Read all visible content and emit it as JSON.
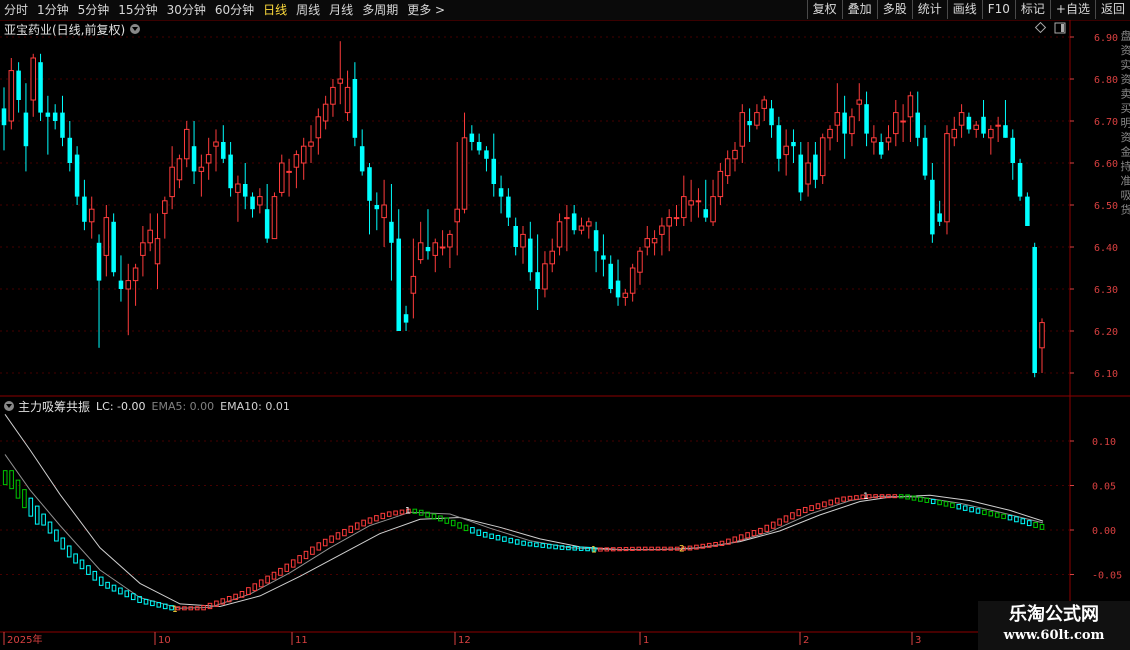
{
  "toolbar": {
    "left": [
      "分时",
      "1分钟",
      "5分钟",
      "15分钟",
      "30分钟",
      "60分钟",
      "日线",
      "周线",
      "月线",
      "多周期",
      "更多 >"
    ],
    "active_index": 6,
    "right": [
      "复权",
      "叠加",
      "多股",
      "统计",
      "画线",
      "F10",
      "标记",
      "+自选",
      "返回"
    ]
  },
  "stock_title": "亚宝药业(日线,前复权)",
  "price_axis": [
    "6.90",
    "6.80",
    "6.70",
    "6.60",
    "6.50",
    "6.40",
    "6.30",
    "6.20",
    "6.10"
  ],
  "indicator": {
    "name": "主力吸筹共振",
    "lc_label": "LC: -0.00",
    "ema5_label": "EMA5: 0.00",
    "ema10_label": "EMA10: 0.01",
    "axis": [
      "0.10",
      "0.05",
      "0.00",
      "-0.05"
    ],
    "markers": [
      "1",
      "1",
      "1",
      "2",
      "1"
    ]
  },
  "date_axis": [
    "2025年",
    "10",
    "11",
    "12",
    "1",
    "2",
    "3"
  ],
  "side_text": "盘 资 实 资 卖 买 明 资 金 持 准 吸 货",
  "watermark": {
    "cn": "乐淘公式网",
    "url": "www.60lt.com"
  },
  "colors": {
    "up": "#ff3c3c",
    "down": "#00ffff",
    "accent": "#ffdc3c",
    "ind_up": "#ff3c3c",
    "ind_down": "#00ffff",
    "ind_green": "#00c800",
    "grid": "#8b0000"
  },
  "chart_data": {
    "type": "candlestick",
    "title": "亚宝药业(日线,前复权)",
    "y_range": [
      6.1,
      6.9
    ],
    "candles_ohlc": [
      [
        6.73,
        6.78,
        6.63,
        6.69
      ],
      [
        6.7,
        6.85,
        6.68,
        6.82
      ],
      [
        6.82,
        6.84,
        6.72,
        6.75
      ],
      [
        6.72,
        6.79,
        6.58,
        6.64
      ],
      [
        6.75,
        6.86,
        6.71,
        6.85
      ],
      [
        6.84,
        6.86,
        6.7,
        6.72
      ],
      [
        6.72,
        6.76,
        6.62,
        6.71
      ],
      [
        6.72,
        6.74,
        6.68,
        6.7
      ],
      [
        6.72,
        6.76,
        6.64,
        6.66
      ],
      [
        6.66,
        6.7,
        6.58,
        6.6
      ],
      [
        6.62,
        6.64,
        6.5,
        6.52
      ],
      [
        6.52,
        6.56,
        6.44,
        6.46
      ],
      [
        6.46,
        6.52,
        6.42,
        6.49
      ],
      [
        6.41,
        6.43,
        6.16,
        6.32
      ],
      [
        6.38,
        6.5,
        6.33,
        6.47
      ],
      [
        6.46,
        6.48,
        6.33,
        6.34
      ],
      [
        6.32,
        6.38,
        6.27,
        6.3
      ],
      [
        6.3,
        6.36,
        6.19,
        6.32
      ],
      [
        6.32,
        6.36,
        6.26,
        6.35
      ],
      [
        6.38,
        6.45,
        6.33,
        6.41
      ],
      [
        6.41,
        6.48,
        6.39,
        6.44
      ],
      [
        6.36,
        6.48,
        6.3,
        6.42
      ],
      [
        6.48,
        6.52,
        6.42,
        6.51
      ],
      [
        6.52,
        6.64,
        6.49,
        6.59
      ],
      [
        6.56,
        6.62,
        6.54,
        6.61
      ],
      [
        6.61,
        6.7,
        6.59,
        6.68
      ],
      [
        6.64,
        6.7,
        6.55,
        6.58
      ],
      [
        6.58,
        6.62,
        6.52,
        6.59
      ],
      [
        6.6,
        6.66,
        6.56,
        6.62
      ],
      [
        6.64,
        6.68,
        6.58,
        6.65
      ],
      [
        6.65,
        6.69,
        6.6,
        6.61
      ],
      [
        6.62,
        6.65,
        6.52,
        6.54
      ],
      [
        6.53,
        6.57,
        6.46,
        6.55
      ],
      [
        6.55,
        6.6,
        6.49,
        6.52
      ],
      [
        6.52,
        6.53,
        6.47,
        6.49
      ],
      [
        6.5,
        6.54,
        6.48,
        6.52
      ],
      [
        6.49,
        6.55,
        6.41,
        6.42
      ],
      [
        6.42,
        6.53,
        6.42,
        6.52
      ],
      [
        6.53,
        6.62,
        6.52,
        6.6
      ],
      [
        6.58,
        6.61,
        6.52,
        6.58
      ],
      [
        6.59,
        6.63,
        6.54,
        6.62
      ],
      [
        6.6,
        6.66,
        6.56,
        6.64
      ],
      [
        6.64,
        6.69,
        6.6,
        6.65
      ],
      [
        6.66,
        6.73,
        6.62,
        6.71
      ],
      [
        6.7,
        6.76,
        6.68,
        6.74
      ],
      [
        6.74,
        6.8,
        6.71,
        6.78
      ],
      [
        6.79,
        6.89,
        6.74,
        6.8
      ],
      [
        6.72,
        6.82,
        6.7,
        6.78
      ],
      [
        6.8,
        6.84,
        6.64,
        6.66
      ],
      [
        6.64,
        6.68,
        6.57,
        6.58
      ],
      [
        6.59,
        6.6,
        6.43,
        6.51
      ],
      [
        6.5,
        6.53,
        6.44,
        6.49
      ],
      [
        6.47,
        6.56,
        6.4,
        6.5
      ],
      [
        6.46,
        6.55,
        6.32,
        6.41
      ],
      [
        6.42,
        6.49,
        6.2,
        6.2
      ],
      [
        6.24,
        6.26,
        6.2,
        6.22
      ],
      [
        6.29,
        6.42,
        6.23,
        6.33
      ],
      [
        6.37,
        6.46,
        6.36,
        6.41
      ],
      [
        6.4,
        6.49,
        6.37,
        6.39
      ],
      [
        6.38,
        6.42,
        6.34,
        6.41
      ],
      [
        6.4,
        6.44,
        6.38,
        6.4
      ],
      [
        6.4,
        6.44,
        6.35,
        6.43
      ],
      [
        6.46,
        6.65,
        6.38,
        6.49
      ],
      [
        6.49,
        6.72,
        6.48,
        6.66
      ],
      [
        6.67,
        6.69,
        6.63,
        6.65
      ],
      [
        6.65,
        6.67,
        6.62,
        6.63
      ],
      [
        6.63,
        6.64,
        6.58,
        6.61
      ],
      [
        6.61,
        6.67,
        6.52,
        6.55
      ],
      [
        6.54,
        6.57,
        6.48,
        6.52
      ],
      [
        6.52,
        6.54,
        6.45,
        6.47
      ],
      [
        6.45,
        6.47,
        6.38,
        6.4
      ],
      [
        6.4,
        6.45,
        6.36,
        6.43
      ],
      [
        6.42,
        6.46,
        6.32,
        6.34
      ],
      [
        6.34,
        6.43,
        6.25,
        6.3
      ],
      [
        6.3,
        6.39,
        6.28,
        6.36
      ],
      [
        6.36,
        6.42,
        6.34,
        6.39
      ],
      [
        6.4,
        6.48,
        6.38,
        6.46
      ],
      [
        6.47,
        6.5,
        6.39,
        6.47
      ],
      [
        6.48,
        6.5,
        6.43,
        6.44
      ],
      [
        6.44,
        6.47,
        6.43,
        6.45
      ],
      [
        6.45,
        6.47,
        6.42,
        6.46
      ],
      [
        6.44,
        6.46,
        6.34,
        6.39
      ],
      [
        6.38,
        6.43,
        6.33,
        6.37
      ],
      [
        6.36,
        6.38,
        6.29,
        6.3
      ],
      [
        6.32,
        6.37,
        6.26,
        6.28
      ],
      [
        6.28,
        6.3,
        6.26,
        6.29
      ],
      [
        6.29,
        6.36,
        6.27,
        6.35
      ],
      [
        6.34,
        6.4,
        6.31,
        6.39
      ],
      [
        6.4,
        6.45,
        6.38,
        6.42
      ],
      [
        6.41,
        6.44,
        6.38,
        6.42
      ],
      [
        6.43,
        6.47,
        6.38,
        6.45
      ],
      [
        6.45,
        6.49,
        6.39,
        6.47
      ],
      [
        6.47,
        6.5,
        6.45,
        6.47
      ],
      [
        6.47,
        6.57,
        6.45,
        6.52
      ],
      [
        6.5,
        6.56,
        6.46,
        6.51
      ],
      [
        6.51,
        6.54,
        6.47,
        6.51
      ],
      [
        6.49,
        6.56,
        6.46,
        6.47
      ],
      [
        6.46,
        6.56,
        6.45,
        6.52
      ],
      [
        6.52,
        6.6,
        6.5,
        6.58
      ],
      [
        6.57,
        6.63,
        6.55,
        6.61
      ],
      [
        6.61,
        6.65,
        6.58,
        6.63
      ],
      [
        6.64,
        6.74,
        6.6,
        6.72
      ],
      [
        6.7,
        6.73,
        6.65,
        6.69
      ],
      [
        6.69,
        6.74,
        6.68,
        6.72
      ],
      [
        6.73,
        6.76,
        6.7,
        6.75
      ],
      [
        6.73,
        6.75,
        6.66,
        6.69
      ],
      [
        6.69,
        6.71,
        6.58,
        6.61
      ],
      [
        6.62,
        6.68,
        6.57,
        6.64
      ],
      [
        6.65,
        6.68,
        6.6,
        6.64
      ],
      [
        6.62,
        6.65,
        6.51,
        6.53
      ],
      [
        6.55,
        6.65,
        6.52,
        6.6
      ],
      [
        6.62,
        6.65,
        6.54,
        6.56
      ],
      [
        6.57,
        6.67,
        6.55,
        6.66
      ],
      [
        6.66,
        6.69,
        6.63,
        6.68
      ],
      [
        6.69,
        6.79,
        6.65,
        6.72
      ],
      [
        6.72,
        6.76,
        6.61,
        6.67
      ],
      [
        6.67,
        6.73,
        6.64,
        6.71
      ],
      [
        6.74,
        6.79,
        6.7,
        6.75
      ],
      [
        6.74,
        6.77,
        6.64,
        6.67
      ],
      [
        6.65,
        6.69,
        6.62,
        6.66
      ],
      [
        6.65,
        6.67,
        6.61,
        6.62
      ],
      [
        6.65,
        6.69,
        6.63,
        6.66
      ],
      [
        6.67,
        6.75,
        6.64,
        6.72
      ],
      [
        6.7,
        6.74,
        6.65,
        6.7
      ],
      [
        6.71,
        6.77,
        6.65,
        6.76
      ],
      [
        6.72,
        6.77,
        6.64,
        6.66
      ],
      [
        6.66,
        6.69,
        6.56,
        6.57
      ],
      [
        6.56,
        6.6,
        6.41,
        6.43
      ],
      [
        6.48,
        6.51,
        6.45,
        6.46
      ],
      [
        6.46,
        6.69,
        6.43,
        6.67
      ],
      [
        6.66,
        6.71,
        6.64,
        6.68
      ],
      [
        6.69,
        6.74,
        6.66,
        6.72
      ],
      [
        6.71,
        6.72,
        6.67,
        6.68
      ],
      [
        6.68,
        6.7,
        6.66,
        6.69
      ],
      [
        6.71,
        6.75,
        6.66,
        6.67
      ],
      [
        6.66,
        6.69,
        6.62,
        6.68
      ],
      [
        6.69,
        6.71,
        6.65,
        6.69
      ],
      [
        6.69,
        6.75,
        6.66,
        6.66
      ],
      [
        6.66,
        6.68,
        6.56,
        6.6
      ],
      [
        6.6,
        6.61,
        6.51,
        6.52
      ],
      [
        6.52,
        6.53,
        6.45,
        6.45
      ],
      [
        6.4,
        6.41,
        6.09,
        6.1
      ],
      [
        6.16,
        6.23,
        6.1,
        6.22
      ]
    ],
    "indicator_markers": [
      "1",
      "1",
      "1",
      "2",
      "1"
    ]
  }
}
